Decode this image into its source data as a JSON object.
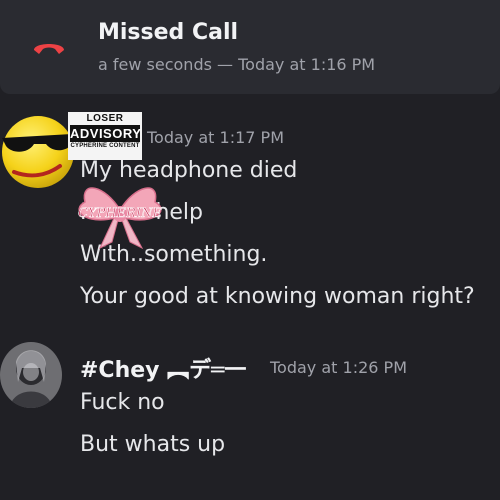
{
  "missed_call": {
    "title": "Missed Call",
    "meta": "a few seconds — Today at 1:16 PM",
    "icon": "phone-hangup-icon",
    "icon_color": "#ed4245"
  },
  "messages": [
    {
      "timestamp": "Today at 1:17 PM",
      "badge": {
        "top": "LOSER",
        "middle": "ADVISORY",
        "bottom": "CYPHERINE CONTENT"
      },
      "lines": [
        "My headphone died",
        "I need help",
        "With..something.",
        "Your good at knowing woman right?"
      ],
      "sticker_text": "CYPHERINE"
    },
    {
      "username": "#Chey ︻デ═一",
      "timestamp": "Today at 1:26 PM",
      "lines": [
        "Fuck no",
        "But whats up"
      ]
    }
  ],
  "colors": {
    "background": "#202025",
    "card": "#2a2b31",
    "text": "#e6e7ea",
    "muted": "#a0a2aa"
  }
}
